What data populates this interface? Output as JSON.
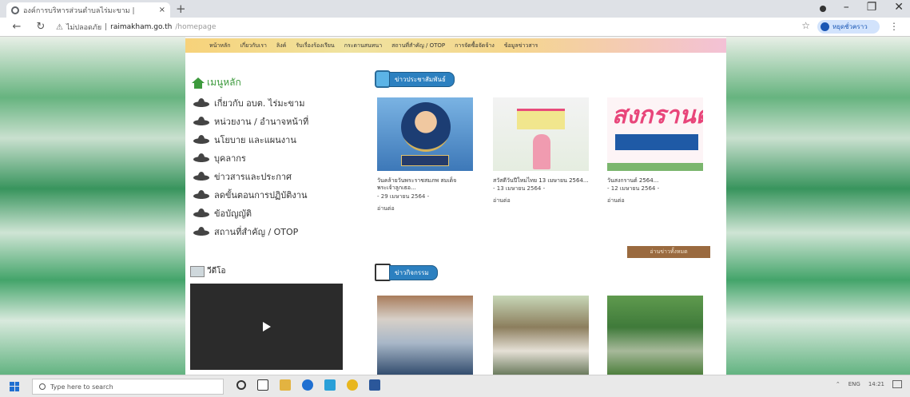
{
  "browser": {
    "tab_title": "องค์การบริหารส่วนตำบลไร่มะขาม |",
    "tab_close": "×",
    "new_tab": "+",
    "url_warning": "ไม่ปลอดภัย",
    "url_host": "raimakham.go.th",
    "url_path": "/homepage",
    "profile_label": "หยุดชั่วคราว"
  },
  "topnav": {
    "items": [
      "หน้าหลัก",
      "เกี่ยวกับเรา",
      "ลิงค์",
      "รับเรื่องร้องเรียน",
      "กระดานสนทนา",
      "สถานที่สำคัญ / OTOP",
      "การจัดซื้อจัดจ้าง",
      "ข้อมูลข่าวสาร"
    ]
  },
  "menu": {
    "title": "เมนูหลัก",
    "items": [
      "เกี่ยวกับ อบต. ไร่มะขาม",
      "หน่วยงาน / อำนาจหน้าที่",
      "นโยบาย และแผนงาน",
      "บุคลากร",
      "ข่าวสารและประกาศ",
      "ลดขั้นตอนการปฏิบัติงาน",
      "ข้อบัญญัติ",
      "สถานที่สำคัญ / OTOP"
    ]
  },
  "video": {
    "title": "วีดีโอ"
  },
  "news": {
    "section_title": "ข่าวประชาสัมพันธ์",
    "cards": [
      {
        "title": "วันคล้ายวันพระราชสมภพ สมเด็จพระเจ้าลูกเธอ...",
        "date": "- 29 เมษายน 2564 -",
        "more": "อ่านต่อ"
      },
      {
        "title": "สวัสดีวันปีใหม่ไทย 13 เมษายน 2564...",
        "date": "- 13 เมษายน 2564 -",
        "more": "อ่านต่อ"
      },
      {
        "title": "วันสงกรานต์ 2564...",
        "date": "- 12 เมษายน 2564 -",
        "more": "อ่านต่อ"
      }
    ],
    "img3_text": "สงกรานต์",
    "all_button": "อ่านข่าวทั้งหมด"
  },
  "activities": {
    "section_title": "ข่าวกิจกรรม"
  },
  "taskbar": {
    "search_placeholder": "Type here to search",
    "lang": "ENG",
    "clock": "14:21"
  }
}
